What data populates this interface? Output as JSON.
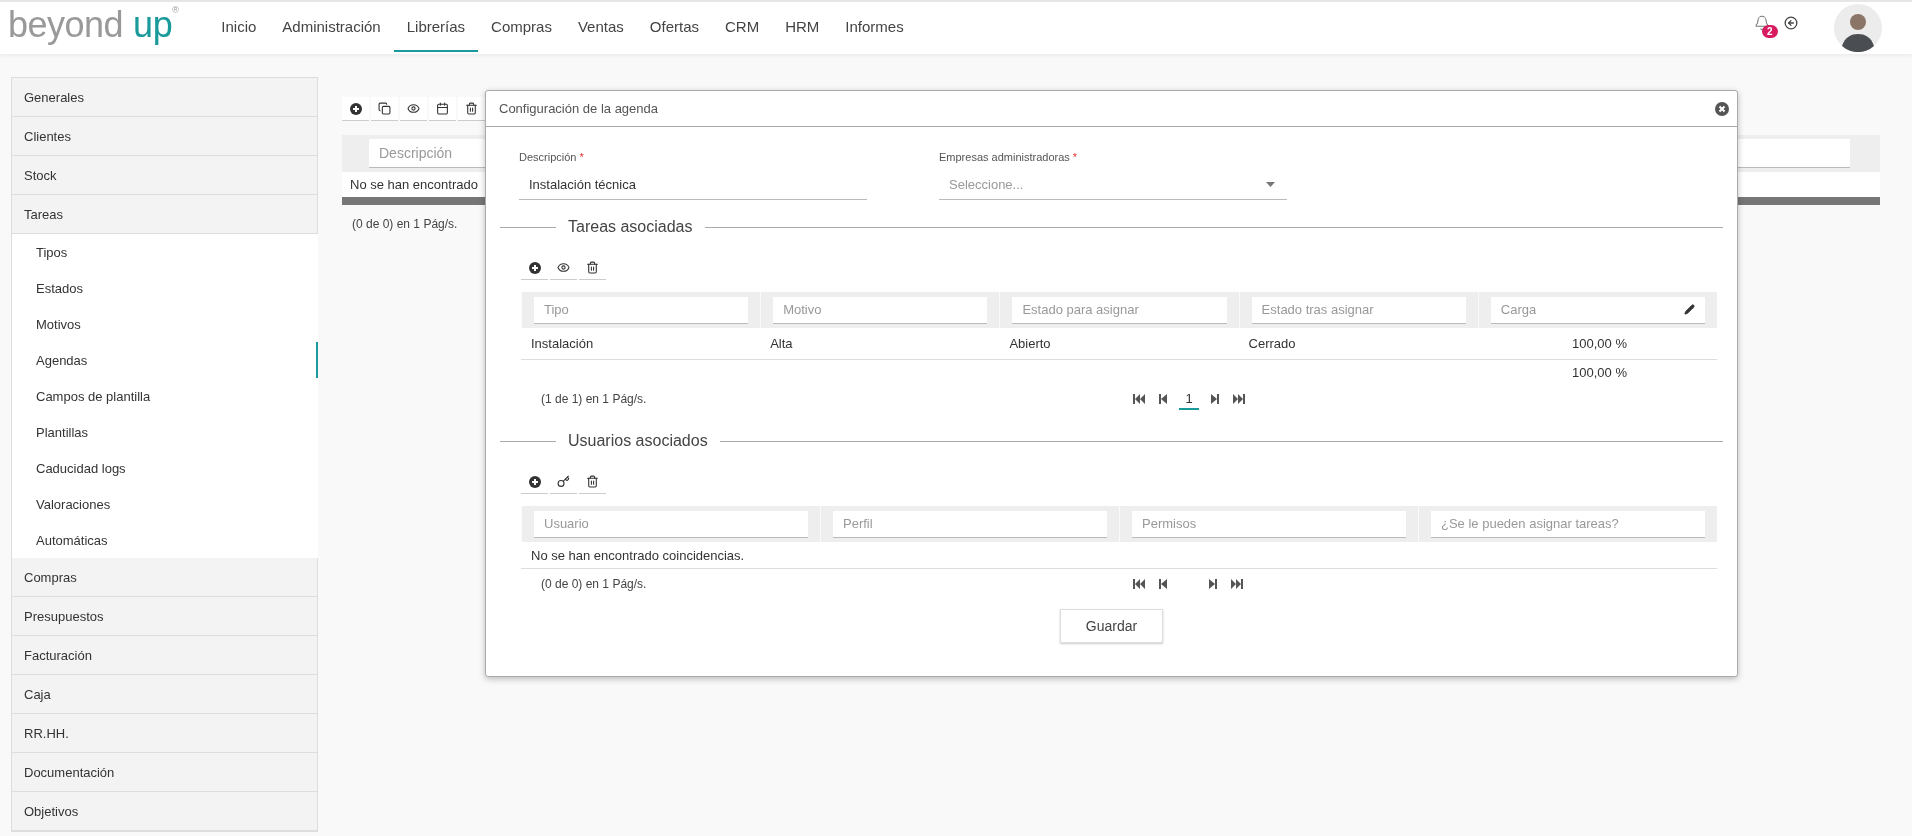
{
  "header": {
    "logo": {
      "text": "beyond",
      "accent": "up",
      "mark": "®"
    },
    "nav": [
      {
        "label": "Inicio",
        "selected": false
      },
      {
        "label": "Administración",
        "selected": false
      },
      {
        "label": "Librerías",
        "selected": true
      },
      {
        "label": "Compras",
        "selected": false
      },
      {
        "label": "Ventas",
        "selected": false
      },
      {
        "label": "Ofertas",
        "selected": false
      },
      {
        "label": "CRM",
        "selected": false
      },
      {
        "label": "HRM",
        "selected": false
      },
      {
        "label": "Informes",
        "selected": false
      }
    ],
    "notifications": {
      "count": "2"
    }
  },
  "sidebar": {
    "items": [
      {
        "label": "Generales"
      },
      {
        "label": "Clientes"
      },
      {
        "label": "Stock"
      },
      {
        "label": "Tareas",
        "children": [
          {
            "label": "Tipos",
            "selected": false
          },
          {
            "label": "Estados",
            "selected": false
          },
          {
            "label": "Motivos",
            "selected": false
          },
          {
            "label": "Agendas",
            "selected": true
          },
          {
            "label": "Campos de plantilla",
            "selected": false
          },
          {
            "label": "Plantillas",
            "selected": false
          },
          {
            "label": "Caducidad logs",
            "selected": false
          },
          {
            "label": "Valoraciones",
            "selected": false
          },
          {
            "label": "Automáticas",
            "selected": false
          }
        ]
      },
      {
        "label": "Compras"
      },
      {
        "label": "Presupuestos"
      },
      {
        "label": "Facturación"
      },
      {
        "label": "Caja"
      },
      {
        "label": "RR.HH."
      },
      {
        "label": "Documentación"
      },
      {
        "label": "Objetivos"
      }
    ]
  },
  "list": {
    "toolbar": [
      {
        "kind": "add"
      },
      {
        "kind": "copy"
      },
      {
        "kind": "view"
      },
      {
        "kind": "calendar"
      },
      {
        "kind": "delete"
      }
    ],
    "filters": [
      {
        "placeholder": "Descripción"
      }
    ],
    "empty_message": "No se han encontrado",
    "pager_info": "(0 de 0) en 1 Pág/s."
  },
  "dialog": {
    "title": "Configuración de la agenda",
    "fields": [
      {
        "kind": "text",
        "label": "Descripción",
        "required_mark": "*",
        "value": "Instalación técnica"
      },
      {
        "kind": "select",
        "label": "Empresas administradoras",
        "required_mark": "*",
        "placeholder": "Seleccione..."
      }
    ],
    "sections": [
      {
        "title": "Tareas asociadas",
        "toolbar": [
          {
            "kind": "add"
          },
          {
            "kind": "view"
          },
          {
            "kind": "delete"
          }
        ],
        "columns": [
          {
            "placeholder": "Tipo"
          },
          {
            "placeholder": "Motivo"
          },
          {
            "placeholder": "Estado para asignar"
          },
          {
            "placeholder": "Estado tras asignar"
          },
          {
            "placeholder": "Carga",
            "editable": true
          }
        ],
        "rows": [
          [
            "Instalación",
            "Alta",
            "Abierto",
            "Cerrado",
            "100,00 %"
          ]
        ],
        "total": "100,00 %",
        "pager_info": "(1 de 1) en 1 Pág/s.",
        "pages": [
          {
            "label": "1",
            "selected": true
          }
        ]
      },
      {
        "title": "Usuarios asociados",
        "toolbar": [
          {
            "kind": "add"
          },
          {
            "kind": "key"
          },
          {
            "kind": "delete"
          }
        ],
        "columns": [
          {
            "placeholder": "Usuario"
          },
          {
            "placeholder": "Perfil"
          },
          {
            "placeholder": "Permisos"
          },
          {
            "placeholder": "¿Se le pueden asignar tareas?"
          }
        ],
        "empty_message": "No se han encontrado coincidencias.",
        "pager_info": "(0 de 0) en 1 Pág/s."
      }
    ],
    "save_button": "Guardar"
  }
}
